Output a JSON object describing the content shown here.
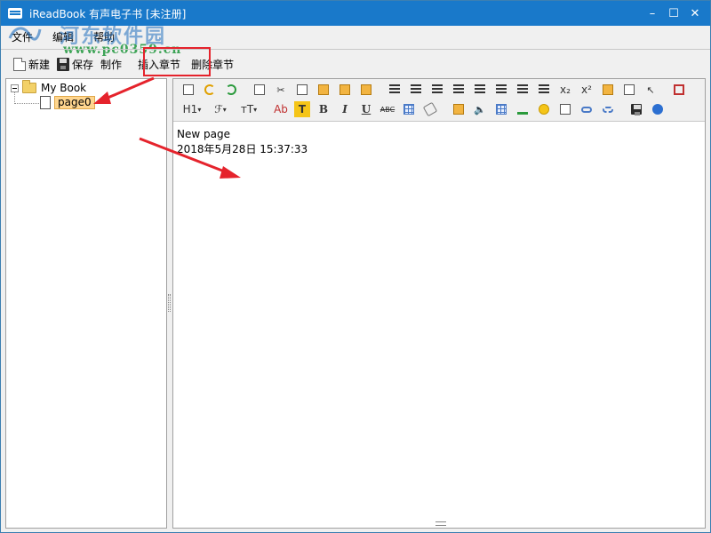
{
  "window": {
    "title": "iReadBook 有声电子书 [未注册]",
    "controls": {
      "minimize": "–",
      "maximize": "☐",
      "close": "✕"
    }
  },
  "watermark": {
    "cn": "河东软件园",
    "url": "www.pc0359.cn"
  },
  "menu": {
    "items": [
      "文件",
      "编辑",
      "帮助"
    ]
  },
  "toolbar": {
    "new_label": "新建",
    "save_label": "保存",
    "make_label": "制作",
    "insert_chapter_label": "插入章节",
    "delete_chapter_label": "删除章节"
  },
  "tree": {
    "root_label": "My Book",
    "child_label": "page0"
  },
  "editor": {
    "toolbar_text": {
      "subscript": "x₂",
      "superscript": "x²",
      "heading": "H1",
      "font_family": "ℱ",
      "font_size": "тT",
      "text_color": "Ab",
      "highlight": "T",
      "bold": "B",
      "italic": "I",
      "underline": "U",
      "strikethrough": "ABC",
      "dropdown_arrow": "▾"
    },
    "content_lines": [
      "New page",
      "2018年5月28日  15:37:33"
    ]
  },
  "colors": {
    "titlebar": "#1979ca",
    "annotation_red": "#e5232c",
    "selection": "#ffd68f"
  }
}
